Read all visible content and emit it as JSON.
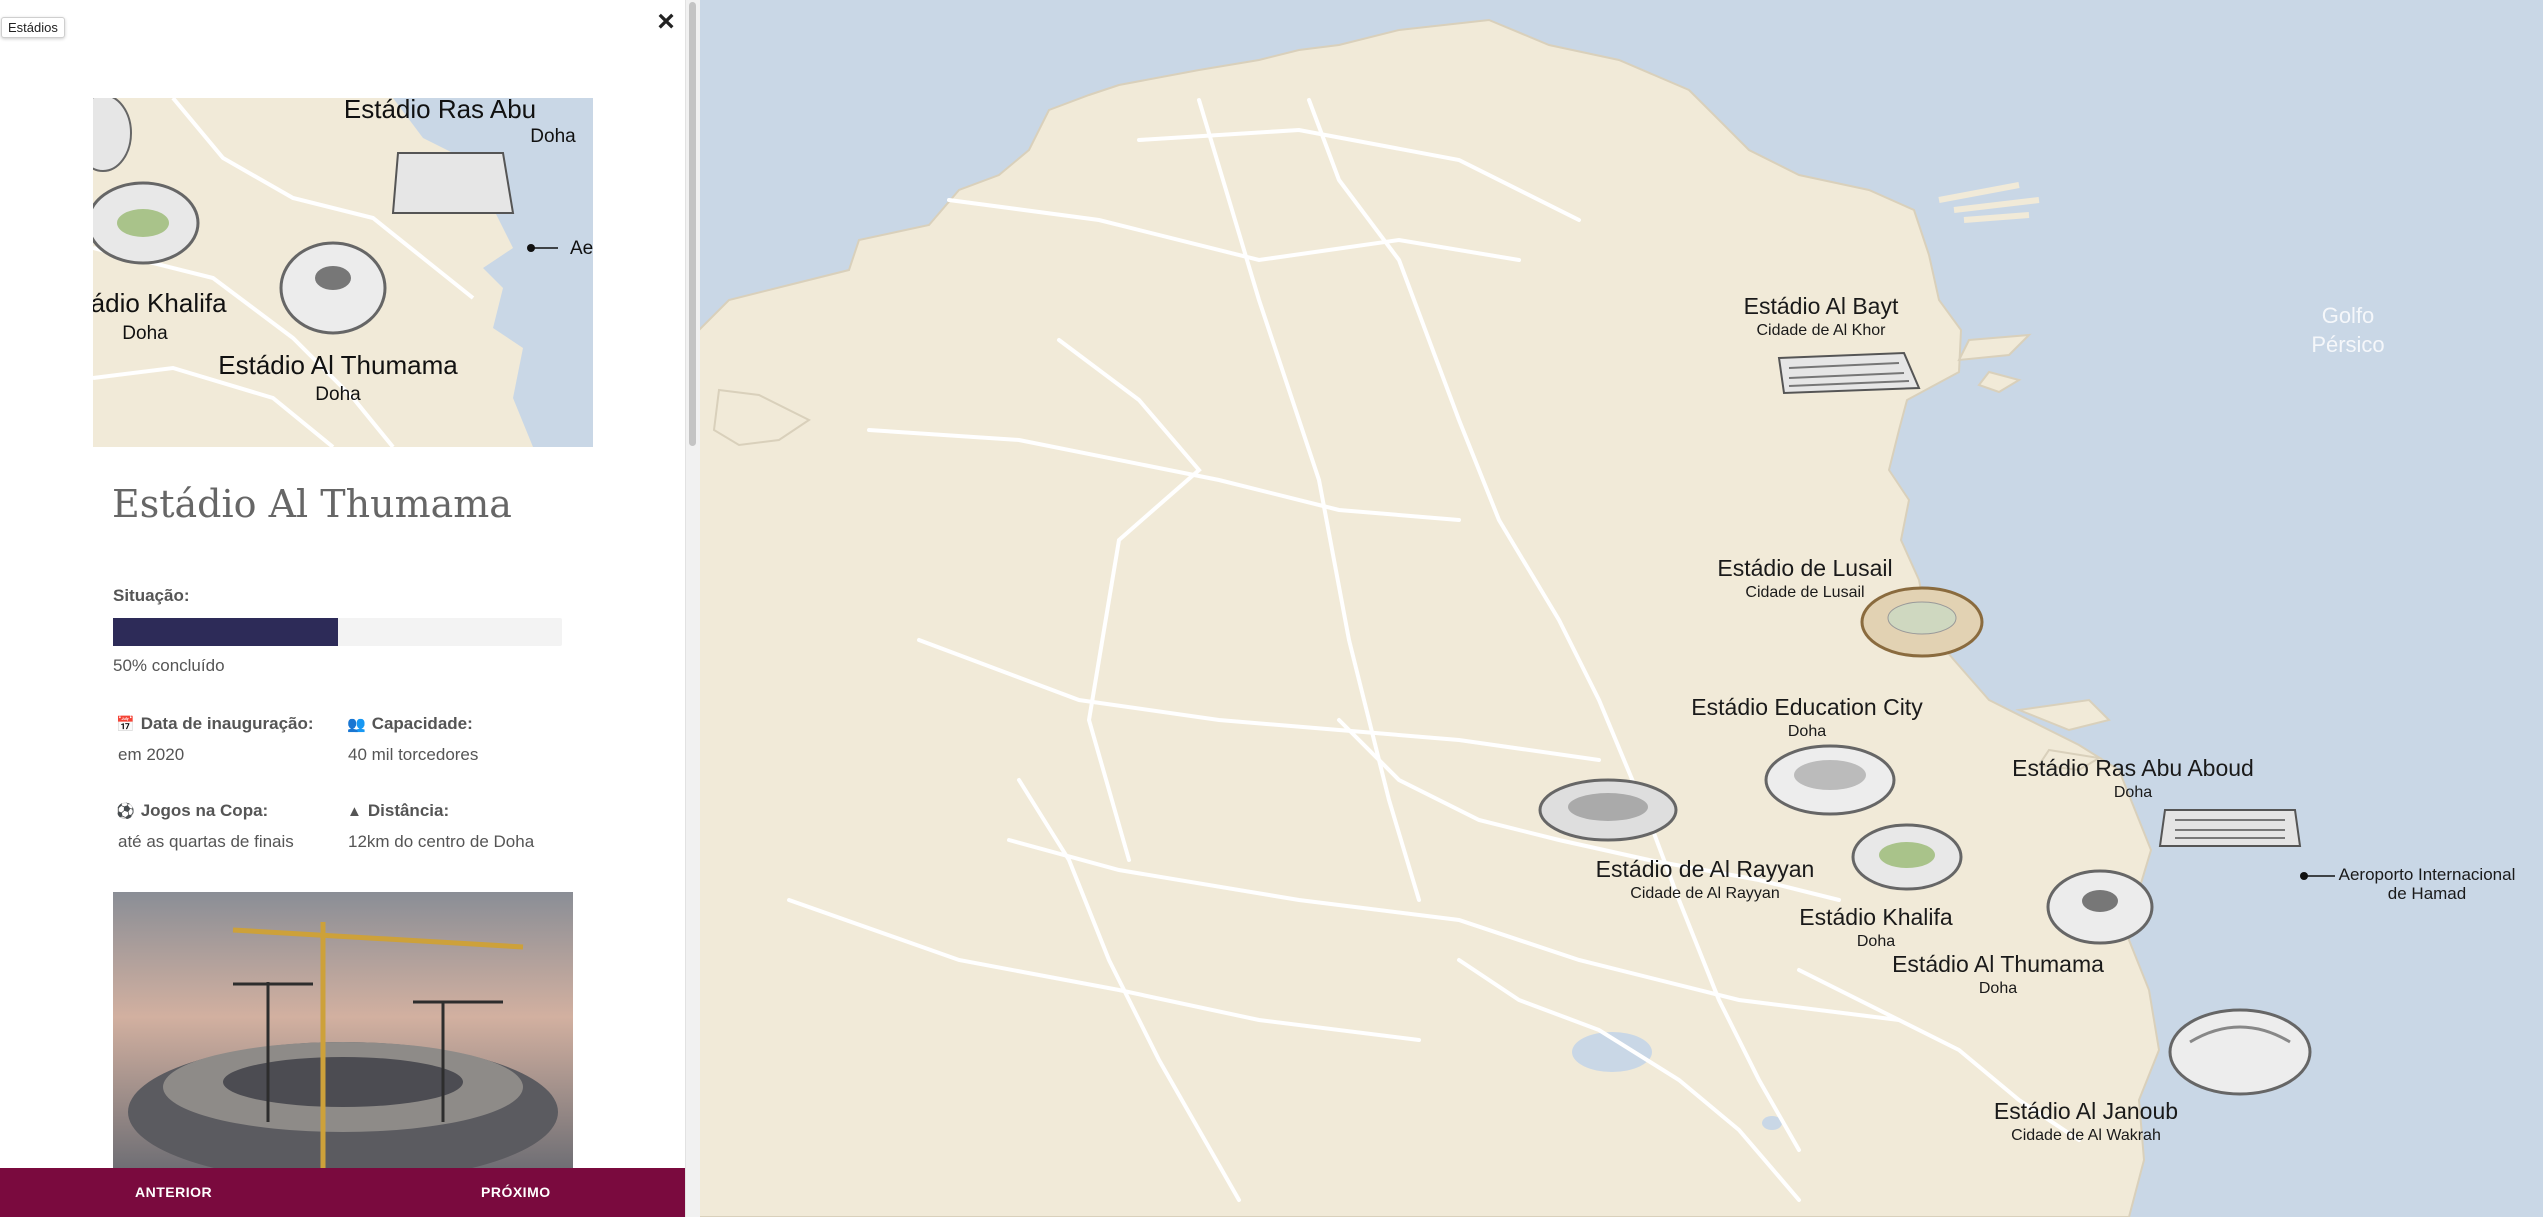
{
  "layer_tag": "Estádios",
  "close_glyph": "×",
  "thumb_labels": {
    "ras_abu_name": "Estádio Ras Abu",
    "ras_abu_city": "Doha",
    "aer": "Aer",
    "khalifa_name": "tádio Khalifa",
    "khalifa_city": "Doha",
    "thumama_name": "Estádio Al Thumama",
    "thumama_city": "Doha"
  },
  "stadium": {
    "name": "Estádio Al Thumama",
    "status_label": "Situação:",
    "progress_percent": 50,
    "progress_text": "50% concluído",
    "inauguration_label": "Data de inauguração:",
    "inauguration_value": "em 2020",
    "capacity_label": "Capacidade:",
    "capacity_value": "40 mil torcedores",
    "games_label": "Jogos na Copa:",
    "games_value": "até as quartas de finais",
    "distance_label": "Distância:",
    "distance_value": "12km do centro de Doha"
  },
  "icons": {
    "calendar": "calendar-icon",
    "users": "users-icon",
    "ball": "soccer-ball-icon",
    "road": "road-icon"
  },
  "footer": {
    "prev_label": "ANTERIOR",
    "next_label": "PRÓXIMO"
  },
  "map": {
    "water_label_1": "Golfo",
    "water_label_2": "Pérsico",
    "airport_1": "Aeroporto Internacional",
    "airport_2": "de Hamad",
    "stadiums": [
      {
        "name": "Estádio Al Bayt",
        "city": "Cidade de Al Khor"
      },
      {
        "name": "Estádio de Lusail",
        "city": "Cidade de Lusail"
      },
      {
        "name": "Estádio Education City",
        "city": "Doha"
      },
      {
        "name": "Estádio Ras Abu Aboud",
        "city": "Doha"
      },
      {
        "name": "Estádio de Al Rayyan",
        "city": "Cidade de Al Rayyan"
      },
      {
        "name": "Estádio Khalifa",
        "city": "Doha"
      },
      {
        "name": "Estádio Al Thumama",
        "city": "Doha"
      },
      {
        "name": "Estádio Al Janoub",
        "city": "Cidade de Al Wakrah"
      }
    ]
  },
  "colors": {
    "water": "#c9d7e6",
    "land": "#f1ead8",
    "roads": "#ffffff",
    "footer": "#7a0a3e",
    "progress": "#2d2b58"
  }
}
